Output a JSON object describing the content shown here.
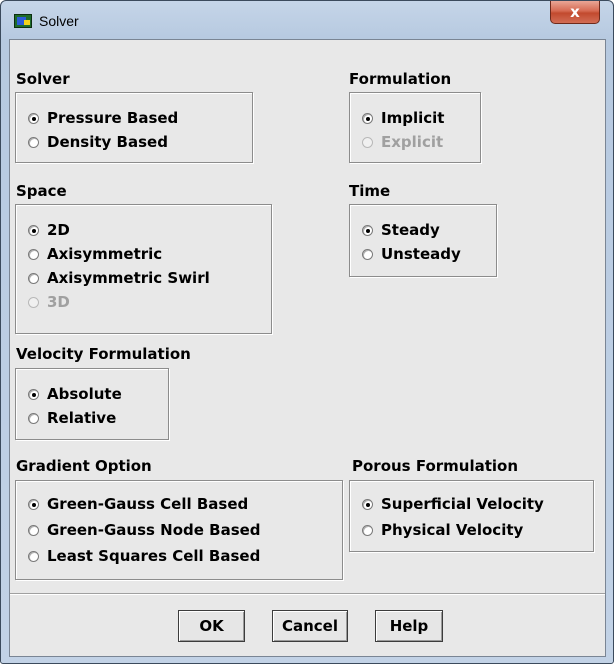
{
  "window": {
    "title": "Solver",
    "close_label": "x"
  },
  "solver": {
    "label": "Solver",
    "options": [
      {
        "label": "Pressure Based",
        "selected": true
      },
      {
        "label": "Density Based",
        "selected": false
      }
    ]
  },
  "formulation": {
    "label": "Formulation",
    "options": [
      {
        "label": "Implicit",
        "selected": true
      },
      {
        "label": "Explicit",
        "selected": false,
        "disabled": true
      }
    ]
  },
  "space": {
    "label": "Space",
    "options": [
      {
        "label": "2D",
        "selected": true
      },
      {
        "label": "Axisymmetric",
        "selected": false
      },
      {
        "label": "Axisymmetric Swirl",
        "selected": false
      },
      {
        "label": "3D",
        "selected": false,
        "disabled": true
      }
    ]
  },
  "time": {
    "label": "Time",
    "options": [
      {
        "label": "Steady",
        "selected": true
      },
      {
        "label": "Unsteady",
        "selected": false
      }
    ]
  },
  "velocity": {
    "label": "Velocity Formulation",
    "options": [
      {
        "label": "Absolute",
        "selected": true
      },
      {
        "label": "Relative",
        "selected": false
      }
    ]
  },
  "gradient": {
    "label": "Gradient Option",
    "options": [
      {
        "label": "Green-Gauss Cell Based",
        "selected": true
      },
      {
        "label": "Green-Gauss Node Based",
        "selected": false
      },
      {
        "label": "Least Squares Cell Based",
        "selected": false
      }
    ]
  },
  "porous": {
    "label": "Porous Formulation",
    "options": [
      {
        "label": "Superficial Velocity",
        "selected": true
      },
      {
        "label": "Physical Velocity",
        "selected": false
      }
    ]
  },
  "buttons": {
    "ok": "OK",
    "cancel": "Cancel",
    "help": "Help"
  }
}
